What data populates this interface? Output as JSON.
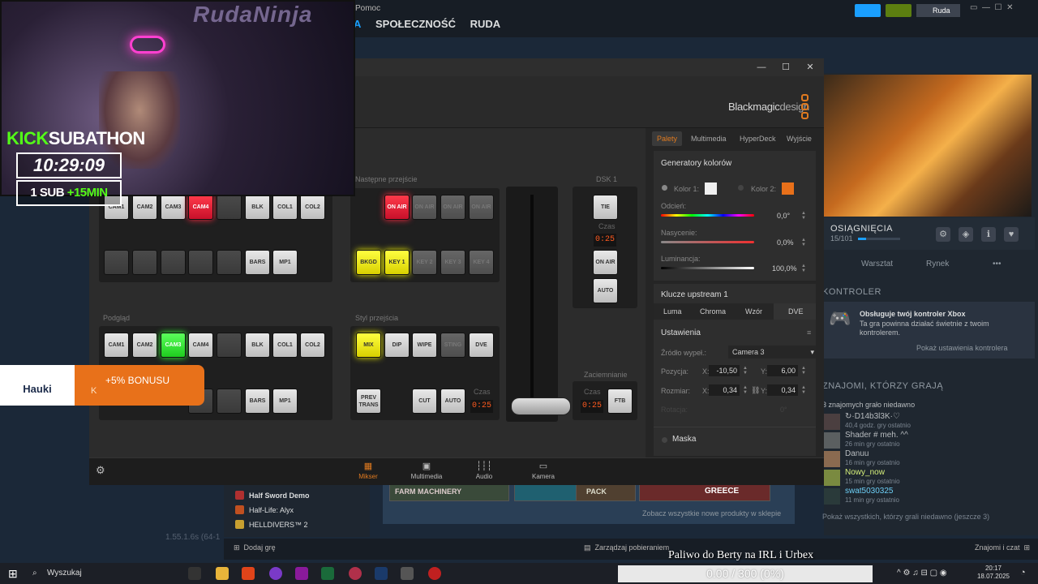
{
  "steam": {
    "menu_help": "Pomoc",
    "nav": [
      "A",
      "SPOŁECZNOŚĆ",
      "RUDA"
    ],
    "user": "Ruda",
    "achievements_title": "OSIĄGNIĘCIA",
    "achievements_count": "15/101",
    "tabs": [
      "Warsztat",
      "Rynek",
      "•••"
    ],
    "controller_title": "KONTROLER",
    "controller_heading": "Obsługuje twój kontroler Xbox",
    "controller_desc": "Ta gra powinna działać świetnie z twoim kontrolerem.",
    "controller_link": "Pokaż ustawienia kontrolera",
    "friends_title": "ZNAJOMI, KTÓRZY GRAJĄ",
    "friends_count": "3 znajomych grało niedawno",
    "friends": [
      {
        "name": "↻·D14b3l3K·♡",
        "time": "40,4 godz. gry ostatnio"
      },
      {
        "name": "Shader # meh. ^^",
        "time": "26 min gry ostatnio"
      },
      {
        "name": "Danuu",
        "time": "16 min gry ostatnio"
      },
      {
        "name": "Nowy_now",
        "time": "15 min gry ostatnio"
      },
      {
        "name": "swat5030325",
        "time": "11 min gry ostatnio"
      }
    ],
    "friends_all": "Pokaż wszystkich, którzy grali niedawno (jeszcze 3)",
    "games": [
      "Half Sword Demo",
      "Half-Life: Alyx",
      "HELLDIVERS™ 2"
    ],
    "store_link": "Zobacz wszystkie nowe produkty w sklepie",
    "store_thumbs": [
      "FARM MACHINERY",
      "",
      "PACK",
      "GREECE"
    ],
    "add_game": "Dodaj grę",
    "manage_downloads": "Zarządzaj pobieraniem",
    "friends_chat": "Znajomi i czat",
    "version": "1.55.1.6s (64-1"
  },
  "atem": {
    "brand": "Blackmagic",
    "brand_suffix": "design",
    "labels": {
      "next_transition": "Następne przejście",
      "dsk": "DSK 1",
      "preview": "Podgląd",
      "transition_style": "Styl przejścia",
      "fade_to_black": "Zaciemnianie",
      "rate": "Czas"
    },
    "program_row": [
      "CAM1",
      "CAM2",
      "CAM3",
      "CAM4",
      "",
      "BLK",
      "COL1",
      "COL2"
    ],
    "program_row2": [
      "",
      "",
      "",
      "",
      "",
      "BARS",
      "MP1"
    ],
    "preview_row": [
      "CAM1",
      "CAM2",
      "CAM3",
      "CAM4",
      "",
      "BLK",
      "COL1",
      "COL2"
    ],
    "preview_row2": [
      "",
      "",
      "",
      "",
      "",
      "BARS",
      "MP1"
    ],
    "next_transition_row1": [
      "ON AIR",
      "ON AIR",
      "ON AIR",
      "ON AIR"
    ],
    "next_transition_row2": [
      "BKGD",
      "KEY 1",
      "KEY 2",
      "KEY 3",
      "KEY 4"
    ],
    "transition_style_row": [
      "MIX",
      "DIP",
      "WIPE",
      "STING",
      "DVE"
    ],
    "prev_trans": "PREV TRANS",
    "cut": "CUT",
    "auto": "AUTO",
    "tie": "TIE",
    "on_air": "ON AIR",
    "ftb": "FTB",
    "rate_value": "0:25",
    "palette": {
      "tabs": [
        "Palety",
        "Multimedia",
        "HyperDeck",
        "Wyjście"
      ],
      "color_gen_title": "Generatory kolorów",
      "color1": "Kolor 1:",
      "color2": "Kolor 2:",
      "hue_label": "Odcień:",
      "hue_value": "0,0°",
      "sat_label": "Nasycenie:",
      "sat_value": "0,0%",
      "lum_label": "Luminancja:",
      "lum_value": "100,0%",
      "upstream_title": "Klucze upstream 1",
      "key_tabs": [
        "Luma",
        "Chroma",
        "Wzór",
        "DVE"
      ],
      "settings": "Ustawienia",
      "fill_source_label": "Źródło wypeł.:",
      "fill_source_value": "Camera 3",
      "position_label": "Pozycja:",
      "pos_x": "-10,50",
      "pos_y": "6,00",
      "size_label": "Rozmiar:",
      "size_x": "0,34",
      "size_y": "0,34",
      "rotation_label": "Rotacja:",
      "rotation_value": "0°",
      "mask": "Maska"
    },
    "bottom_tabs": [
      "Mikser",
      "Multimedia",
      "Audio",
      "Kamera"
    ]
  },
  "stream": {
    "title": "RudaNinja",
    "kick": "KICK",
    "subathon": "SUBATHON",
    "timer": "10:29:09",
    "sub_text": "1 SUB",
    "sub_bonus": "+15MIN",
    "hauki_logo": "Hauki",
    "hauki_bonus": "+5% BONUSU",
    "hauki_k": "K",
    "overlay_text": "Paliwo do Berty na IRL i Urbex",
    "progress": "0.00 / 300 (0%)",
    "progress_fraction": 0.0
  },
  "taskbar": {
    "search_placeholder": "Wyszukaj",
    "time": "20:17",
    "date": "18.07.2025"
  },
  "colors": {
    "accent": "#e07a1f",
    "steam_blue": "#1a9fff",
    "kick_green": "#53fc18",
    "color2_swatch": "#e8701a"
  }
}
